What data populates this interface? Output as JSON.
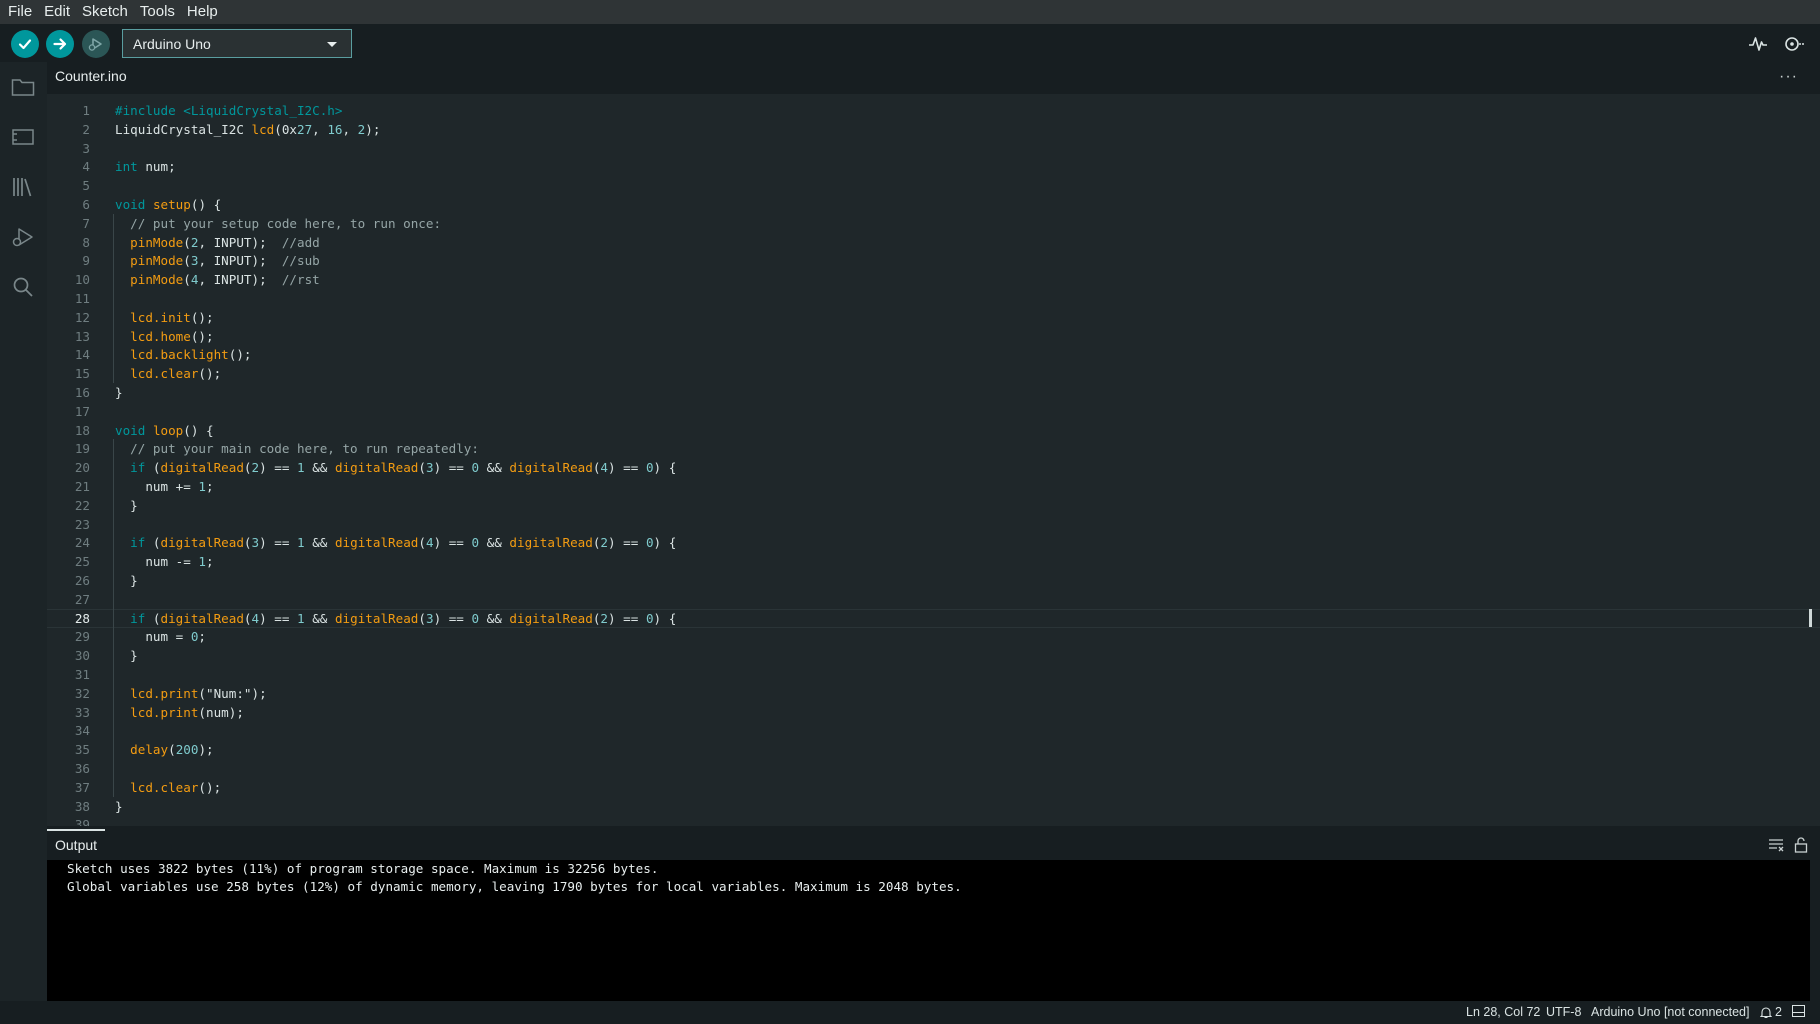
{
  "menu": [
    "File",
    "Edit",
    "Sketch",
    "Tools",
    "Help"
  ],
  "toolbar": {
    "board": "Arduino Uno",
    "verify_icon": "check-icon",
    "upload_icon": "arrow-right-icon",
    "debug_icon": "debug-icon",
    "serial_plotter_icon": "serial-plotter-icon",
    "serial_monitor_icon": "serial-monitor-icon"
  },
  "sidebar": {
    "icons": [
      "sketchbook-folder-icon",
      "boards-manager-icon",
      "library-manager-icon",
      "debug-icon",
      "search-icon"
    ]
  },
  "editor": {
    "tab": "Counter.ino",
    "more": "···",
    "active_line": 28,
    "lines": [
      [
        [
          "pp",
          "#include <LiquidCrystal_I2C.h>"
        ]
      ],
      [
        [
          "t",
          "LiquidCrystal_I2C "
        ],
        [
          "fn",
          "lcd"
        ],
        [
          "t",
          "(0x"
        ],
        [
          "num",
          "27"
        ],
        [
          "t",
          ", "
        ],
        [
          "num",
          "16"
        ],
        [
          "t",
          ", "
        ],
        [
          "num",
          "2"
        ],
        [
          "t",
          ");"
        ]
      ],
      [],
      [
        [
          "kw",
          "int"
        ],
        [
          "t",
          " num;"
        ]
      ],
      [],
      [
        [
          "kw",
          "void"
        ],
        [
          "t",
          " "
        ],
        [
          "fn",
          "setup"
        ],
        [
          "t",
          "() {"
        ]
      ],
      [
        [
          "t",
          "  "
        ],
        [
          "cm",
          "// put your setup code here, to run once:"
        ]
      ],
      [
        [
          "t",
          "  "
        ],
        [
          "fn",
          "pinMode"
        ],
        [
          "t",
          "("
        ],
        [
          "num",
          "2"
        ],
        [
          "t",
          ", INPUT);  "
        ],
        [
          "cm",
          "//add"
        ]
      ],
      [
        [
          "t",
          "  "
        ],
        [
          "fn",
          "pinMode"
        ],
        [
          "t",
          "("
        ],
        [
          "num",
          "3"
        ],
        [
          "t",
          ", INPUT);  "
        ],
        [
          "cm",
          "//sub"
        ]
      ],
      [
        [
          "t",
          "  "
        ],
        [
          "fn",
          "pinMode"
        ],
        [
          "t",
          "("
        ],
        [
          "num",
          "4"
        ],
        [
          "t",
          ", INPUT);  "
        ],
        [
          "cm",
          "//rst"
        ]
      ],
      [],
      [
        [
          "t",
          "  "
        ],
        [
          "fn",
          "lcd.init"
        ],
        [
          "t",
          "();"
        ]
      ],
      [
        [
          "t",
          "  "
        ],
        [
          "fn",
          "lcd.home"
        ],
        [
          "t",
          "();"
        ]
      ],
      [
        [
          "t",
          "  "
        ],
        [
          "fn",
          "lcd.backlight"
        ],
        [
          "t",
          "();"
        ]
      ],
      [
        [
          "t",
          "  "
        ],
        [
          "fn",
          "lcd.clear"
        ],
        [
          "t",
          "();"
        ]
      ],
      [
        [
          "t",
          "}"
        ]
      ],
      [],
      [
        [
          "kw",
          "void"
        ],
        [
          "t",
          " "
        ],
        [
          "fn",
          "loop"
        ],
        [
          "t",
          "() {"
        ]
      ],
      [
        [
          "t",
          "  "
        ],
        [
          "cm",
          "// put your main code here, to run repeatedly:"
        ]
      ],
      [
        [
          "t",
          "  "
        ],
        [
          "kw",
          "if"
        ],
        [
          "t",
          " ("
        ],
        [
          "fn",
          "digitalRead"
        ],
        [
          "t",
          "("
        ],
        [
          "num",
          "2"
        ],
        [
          "t",
          ") == "
        ],
        [
          "num",
          "1"
        ],
        [
          "t",
          " && "
        ],
        [
          "fn",
          "digitalRead"
        ],
        [
          "t",
          "("
        ],
        [
          "num",
          "3"
        ],
        [
          "t",
          ") == "
        ],
        [
          "num",
          "0"
        ],
        [
          "t",
          " && "
        ],
        [
          "fn",
          "digitalRead"
        ],
        [
          "t",
          "("
        ],
        [
          "num",
          "4"
        ],
        [
          "t",
          ") == "
        ],
        [
          "num",
          "0"
        ],
        [
          "t",
          ") {"
        ]
      ],
      [
        [
          "t",
          "    num += "
        ],
        [
          "num",
          "1"
        ],
        [
          "t",
          ";"
        ]
      ],
      [
        [
          "t",
          "  }"
        ]
      ],
      [],
      [
        [
          "t",
          "  "
        ],
        [
          "kw",
          "if"
        ],
        [
          "t",
          " ("
        ],
        [
          "fn",
          "digitalRead"
        ],
        [
          "t",
          "("
        ],
        [
          "num",
          "3"
        ],
        [
          "t",
          ") == "
        ],
        [
          "num",
          "1"
        ],
        [
          "t",
          " && "
        ],
        [
          "fn",
          "digitalRead"
        ],
        [
          "t",
          "("
        ],
        [
          "num",
          "4"
        ],
        [
          "t",
          ") == "
        ],
        [
          "num",
          "0"
        ],
        [
          "t",
          " && "
        ],
        [
          "fn",
          "digitalRead"
        ],
        [
          "t",
          "("
        ],
        [
          "num",
          "2"
        ],
        [
          "t",
          ") == "
        ],
        [
          "num",
          "0"
        ],
        [
          "t",
          ") {"
        ]
      ],
      [
        [
          "t",
          "    num -= "
        ],
        [
          "num",
          "1"
        ],
        [
          "t",
          ";"
        ]
      ],
      [
        [
          "t",
          "  }"
        ]
      ],
      [],
      [
        [
          "t",
          "  "
        ],
        [
          "kw",
          "if"
        ],
        [
          "t",
          " ("
        ],
        [
          "fn",
          "digitalRead"
        ],
        [
          "t",
          "("
        ],
        [
          "num",
          "4"
        ],
        [
          "t",
          ") == "
        ],
        [
          "num",
          "1"
        ],
        [
          "t",
          " && "
        ],
        [
          "fn",
          "digitalRead"
        ],
        [
          "t",
          "("
        ],
        [
          "num",
          "3"
        ],
        [
          "t",
          ") == "
        ],
        [
          "num",
          "0"
        ],
        [
          "t",
          " && "
        ],
        [
          "fn",
          "digitalRead"
        ],
        [
          "t",
          "("
        ],
        [
          "num",
          "2"
        ],
        [
          "t",
          ") == "
        ],
        [
          "num",
          "0"
        ],
        [
          "t",
          ") {"
        ]
      ],
      [
        [
          "t",
          "    num = "
        ],
        [
          "num",
          "0"
        ],
        [
          "t",
          ";"
        ]
      ],
      [
        [
          "t",
          "  }"
        ]
      ],
      [],
      [
        [
          "t",
          "  "
        ],
        [
          "fn",
          "lcd.print"
        ],
        [
          "t",
          "(\"Num:\");"
        ]
      ],
      [
        [
          "t",
          "  "
        ],
        [
          "fn",
          "lcd.print"
        ],
        [
          "t",
          "(num);"
        ]
      ],
      [],
      [
        [
          "t",
          "  "
        ],
        [
          "fn",
          "delay"
        ],
        [
          "t",
          "("
        ],
        [
          "num",
          "200"
        ],
        [
          "t",
          ");"
        ]
      ],
      [],
      [
        [
          "t",
          "  "
        ],
        [
          "fn",
          "lcd.clear"
        ],
        [
          "t",
          "();"
        ]
      ],
      [
        [
          "t",
          "}"
        ]
      ],
      []
    ]
  },
  "output": {
    "title": "Output",
    "lines": [
      "Sketch uses 3822 bytes (11%) of program storage space. Maximum is 32256 bytes.",
      "Global variables use 258 bytes (12%) of dynamic memory, leaving 1790 bytes for local variables. Maximum is 2048 bytes."
    ]
  },
  "status": {
    "position": "Ln 28, Col 72",
    "encoding": "UTF-8",
    "board": "Arduino Uno [not connected]",
    "notifications": "2"
  }
}
